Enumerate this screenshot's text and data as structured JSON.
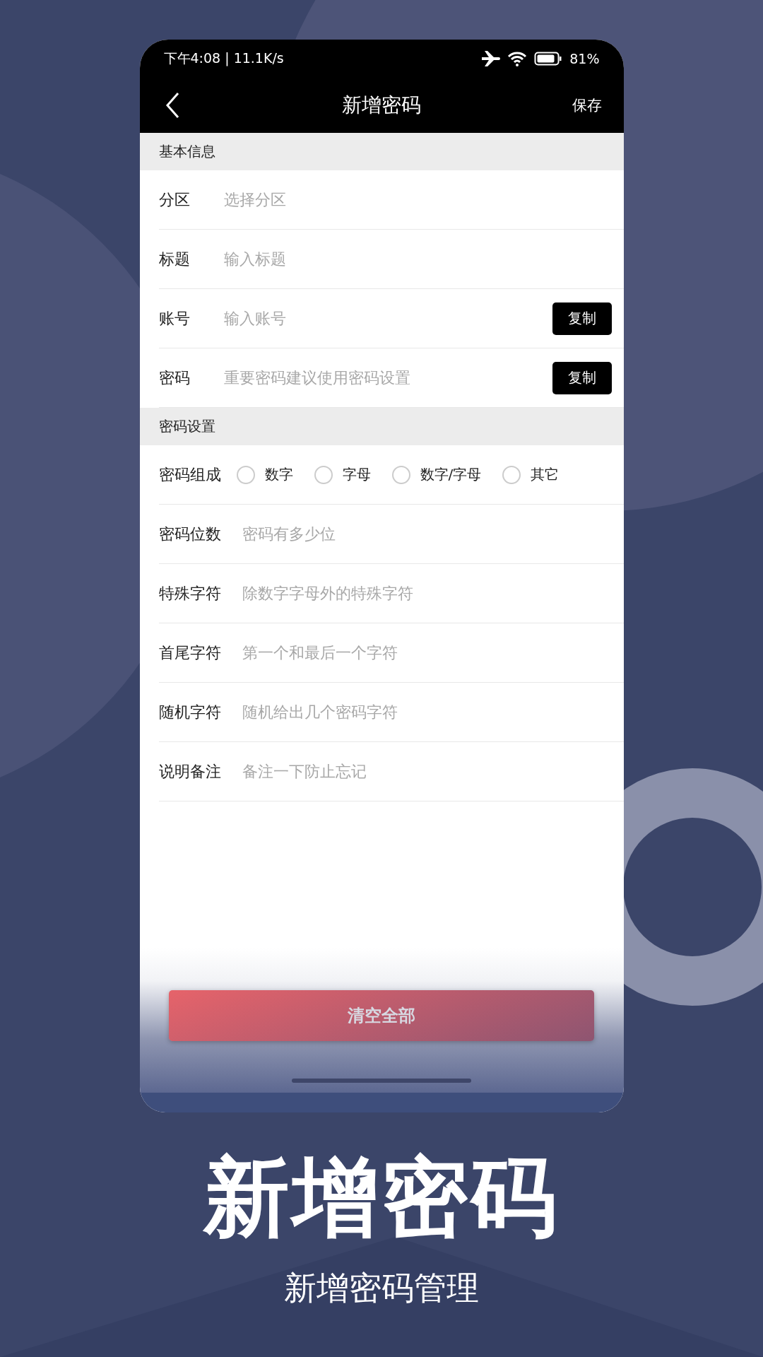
{
  "status_bar": {
    "time": "下午4:08 | 11.1K/s",
    "battery": "81%"
  },
  "nav": {
    "title": "新增密码",
    "action": "保存"
  },
  "sections": [
    {
      "header": "基本信息",
      "fields": [
        {
          "kind": "input",
          "label": "分区",
          "placeholder": "选择分区"
        },
        {
          "kind": "input",
          "label": "标题",
          "placeholder": "输入标题"
        },
        {
          "kind": "input",
          "label": "账号",
          "placeholder": "输入账号",
          "button": "复制"
        },
        {
          "kind": "input",
          "label": "密码",
          "placeholder": "重要密码建议使用密码设置",
          "button": "复制"
        }
      ]
    },
    {
      "header": "密码设置",
      "fields": [
        {
          "kind": "radio",
          "label": "密码组成",
          "options": [
            {
              "label": "数字",
              "selected": false
            },
            {
              "label": "字母",
              "selected": false
            },
            {
              "label": "数字/字母",
              "selected": false
            },
            {
              "label": "其它",
              "selected": false
            }
          ]
        },
        {
          "kind": "input",
          "label": "密码位数",
          "placeholder": "密码有多少位"
        },
        {
          "kind": "input",
          "label": "特殊字符",
          "placeholder": "除数字字母外的特殊字符"
        },
        {
          "kind": "input",
          "label": "首尾字符",
          "placeholder": "第一个和最后一个字符"
        },
        {
          "kind": "input",
          "label": "随机字符",
          "placeholder": "随机给出几个密码字符"
        },
        {
          "kind": "input",
          "label": "说明备注",
          "placeholder": "备注一下防止忘记"
        }
      ]
    }
  ],
  "clear_button": "清空全部",
  "promo": {
    "title": "新增密码",
    "subtitle": "新增密码管理"
  }
}
